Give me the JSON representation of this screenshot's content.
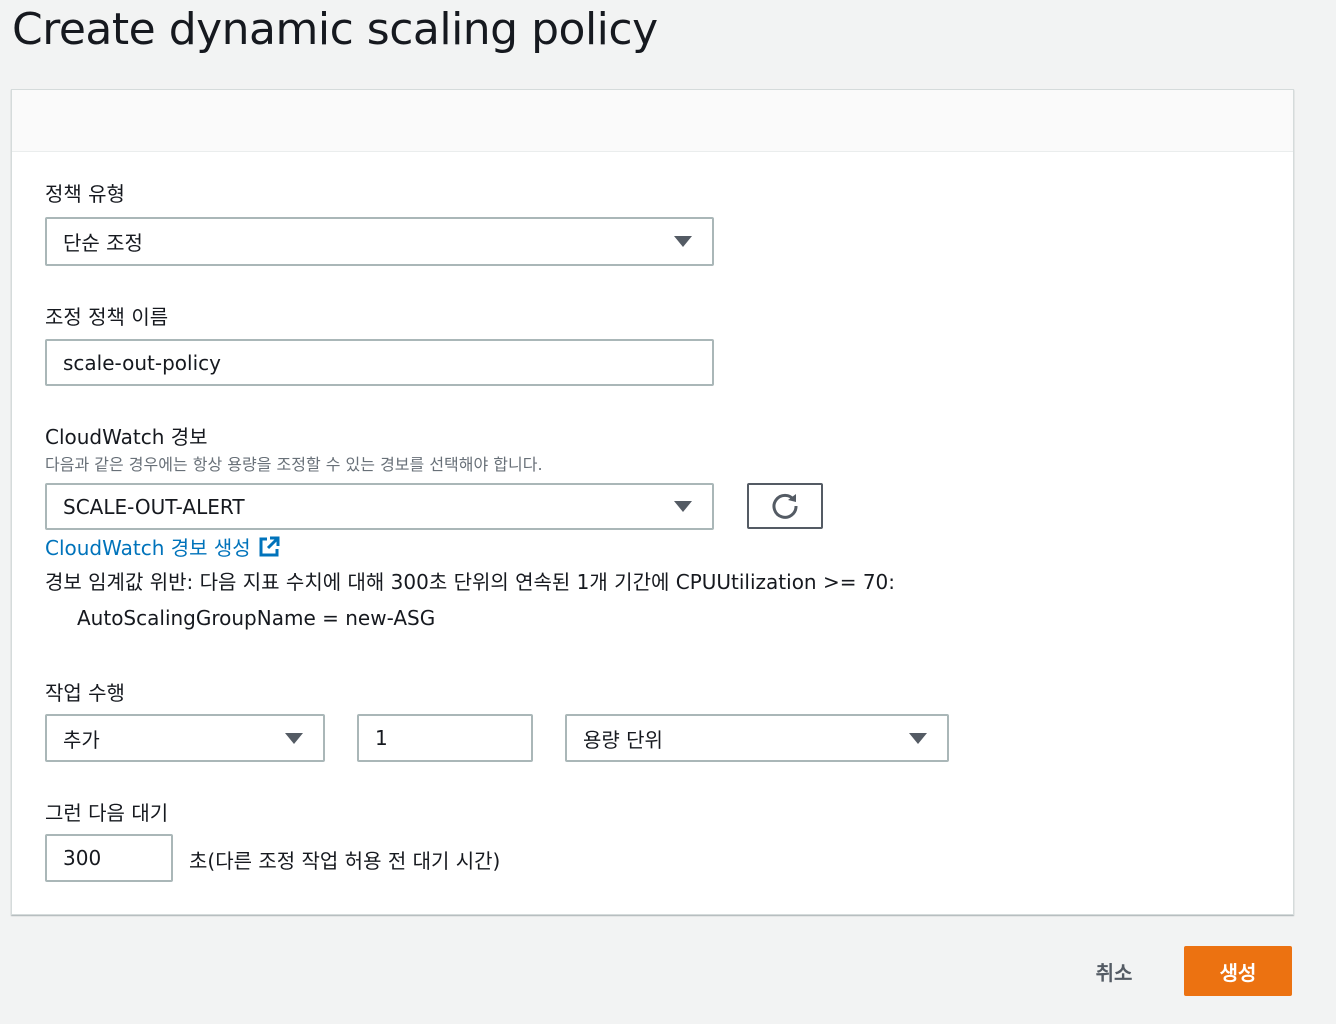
{
  "page": {
    "title": "Create dynamic scaling policy"
  },
  "form": {
    "policy_type": {
      "label": "정책 유형",
      "value": "단순 조정"
    },
    "policy_name": {
      "label": "조정 정책 이름",
      "value": "scale-out-policy"
    },
    "alarm": {
      "label": "CloudWatch 경보",
      "description": "다음과 같은 경우에는 항상 용량을 조정할 수 있는 경보를 선택해야 합니다.",
      "value": "SCALE-OUT-ALERT",
      "create_link": "CloudWatch 경보 생성",
      "breach_text": "경보 임계값 위반: 다음 지표 수치에 대해 300초 단위의 연속된 1개 기간에 CPUUtilization >= 70:",
      "dimension": "AutoScalingGroupName = new-ASG"
    },
    "action": {
      "label": "작업 수행",
      "operation": "추가",
      "amount": "1",
      "unit": "용량 단위"
    },
    "wait": {
      "label": "그런 다음 대기",
      "value": "300",
      "suffix": "초(다른 조정 작업 허용 전 대기 시간)"
    }
  },
  "footer": {
    "cancel_label": "취소",
    "create_label": "생성"
  },
  "colors": {
    "accent": "#ec7211",
    "link": "#0073bb",
    "border": "#aab7b8"
  }
}
